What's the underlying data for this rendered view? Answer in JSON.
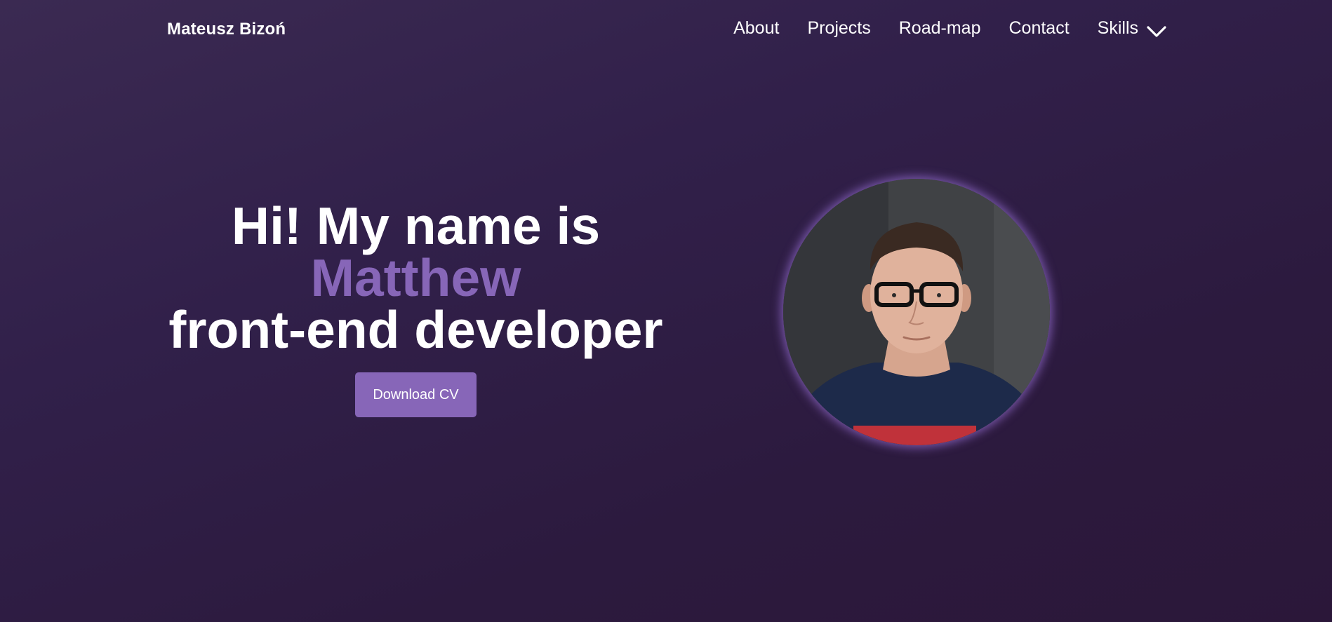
{
  "navbar": {
    "brand": "Mateusz Bizoń",
    "links": [
      {
        "label": "About"
      },
      {
        "label": "Projects"
      },
      {
        "label": "Road-map"
      },
      {
        "label": "Contact"
      },
      {
        "label": "Skills",
        "icon": "chevron-down-icon"
      }
    ]
  },
  "hero": {
    "line1": "Hi! My name is",
    "name": "Matthew",
    "line3": "front-end developer",
    "cv_button": "Download CV"
  },
  "colors": {
    "accent": "#8766b8",
    "background_top": "#3b2a52",
    "background_bottom": "#2b1739",
    "text": "#ffffff"
  }
}
